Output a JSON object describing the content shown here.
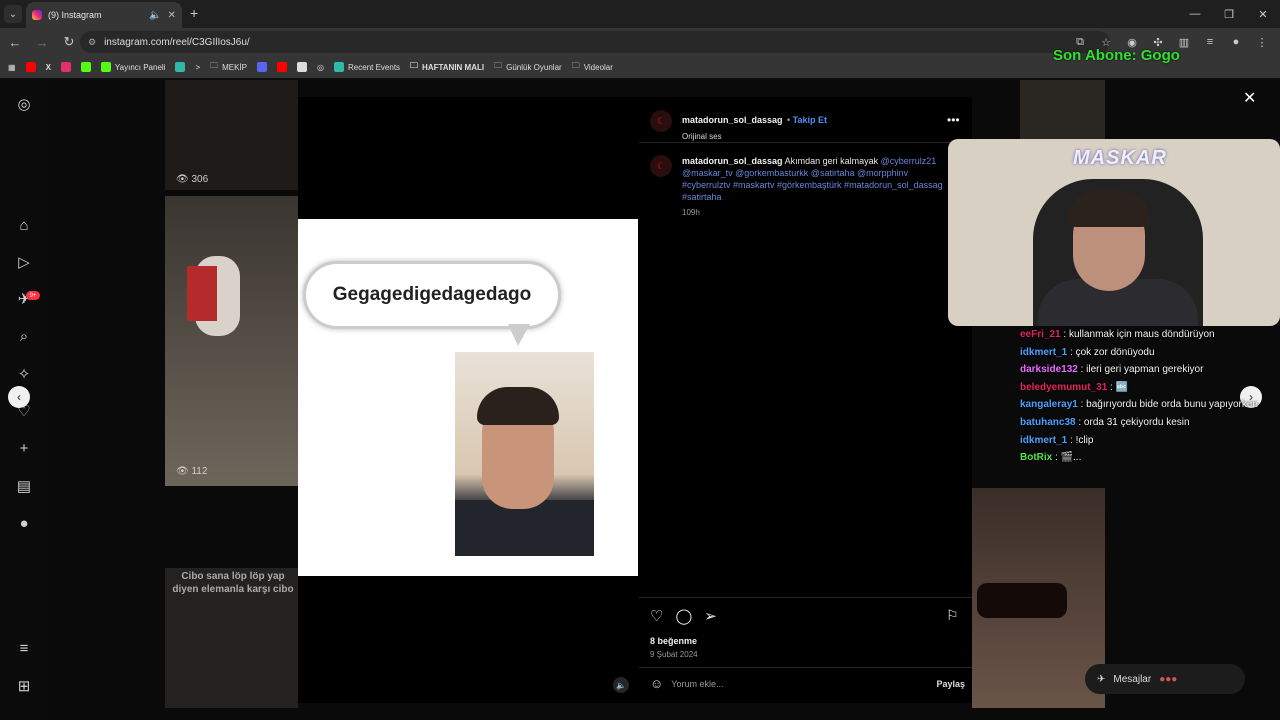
{
  "browser": {
    "tab_title": "(9) Instagram",
    "url": "instagram.com/reel/C3GIlIosJ6u/",
    "bookmarks": [
      "Yayıncı Paneli",
      "MEKİP",
      "Recent Events",
      "HAFTANIN MALI",
      "Günlük Oyunlar",
      "Videolar"
    ]
  },
  "overlay": {
    "son_abone": "Son Abone: Gogo",
    "cam_logo": "MASKAR"
  },
  "sidebar": {
    "notification_badge": "9+"
  },
  "grid": {
    "counts": [
      "306",
      "112"
    ],
    "cibo_text": "Cibo sana löp löp yap diyen elemanla karşı cibo"
  },
  "reel": {
    "bubble_text": "Gegagedigedagedago"
  },
  "post": {
    "username": "matadorun_sol_dassag",
    "follow": "Takip Et",
    "audio": "Orijinal ses",
    "caption_user": "matadorun_sol_dassag",
    "caption_text": "Akımdan geri kalmayak",
    "caption_links": "@cyberrulz21 @maskar_tv @gorkembasturkk @satirtaha @morpphinv #cyberrulztv #maskartv #görkembaştürk #matadorun_sol_dassag #satirtaha",
    "time": "109h",
    "likes": "8 beğenme",
    "date": "9 Şubat 2024",
    "comment_placeholder": "Yorum ekle...",
    "share": "Paylaş"
  },
  "chat": [
    {
      "user": "eeFri_21",
      "color": "#e0245e",
      "msg": "kullanmak için maus döndürüyon"
    },
    {
      "user": "idkmert_1",
      "color": "#4aa0ff",
      "msg": "çok zor dönüyodu"
    },
    {
      "user": "darkside132",
      "color": "#e86cff",
      "msg": "ileri geri yapman gerekiyor"
    },
    {
      "user": "beledyemumut_31",
      "color": "#e0245e",
      "msg": "🔤"
    },
    {
      "user": "kangaleray1",
      "color": "#4aa0ff",
      "msg": "bağırıyordu bide orda bunu yapıyorken"
    },
    {
      "user": "batuhanc38",
      "color": "#4aa0ff",
      "msg": "orda 31 çekiyordu kesin"
    },
    {
      "user": "idkmert_1",
      "color": "#4aa0ff",
      "msg": "!clip"
    },
    {
      "user": "BotRix",
      "color": "#54e346",
      "msg": "🎬..."
    }
  ],
  "messages_label": "Mesajlar",
  "colors": {
    "accent_link": "#4b8ff7",
    "overlay_green": "#2fe02f"
  }
}
